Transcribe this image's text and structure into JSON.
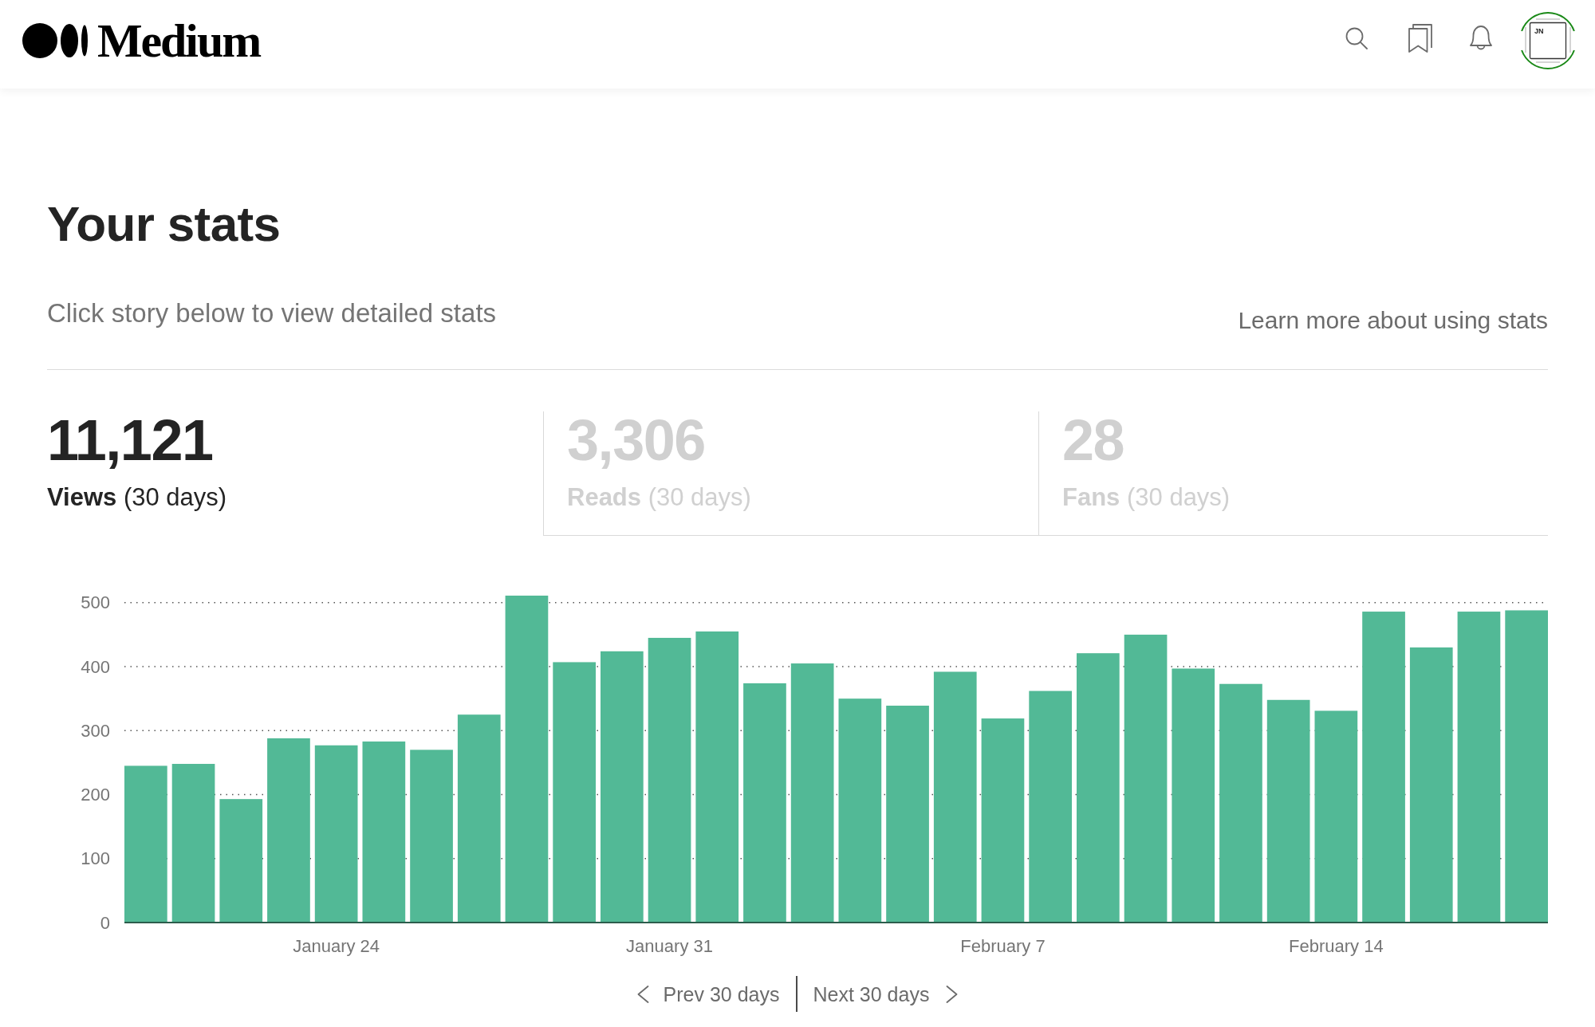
{
  "header": {
    "logo": "Medium",
    "avatar": {
      "initials": "JN"
    }
  },
  "page": {
    "title": "Your stats",
    "subtitle": "Click story below to view detailed stats",
    "help_link": "Learn more about using stats"
  },
  "stats": [
    {
      "value": "11,121",
      "label": "**Views** (30 days)",
      "selected": true
    },
    {
      "value": "3,306",
      "label": "**Reads** (30 days)",
      "selected": false
    },
    {
      "value": "28",
      "label": "**Fans** (30 days)",
      "selected": false
    }
  ],
  "views_chart": {
    "chart_data": {
      "type": "bar",
      "categories": [
        null,
        null,
        null,
        null,
        "January 24",
        null,
        null,
        null,
        null,
        null,
        null,
        "January 31",
        null,
        null,
        null,
        null,
        null,
        null,
        "February 7",
        null,
        null,
        null,
        null,
        null,
        null,
        "February 14",
        null,
        null,
        null,
        null
      ],
      "values": [
        245,
        248,
        193,
        288,
        277,
        283,
        270,
        325,
        511,
        407,
        424,
        445,
        455,
        374,
        405,
        350,
        339,
        392,
        319,
        362,
        421,
        450,
        397,
        373,
        348,
        331,
        486,
        430,
        486,
        488
      ],
      "color": "#52b996",
      "ylim": [
        0,
        511
      ],
      "yticks": [
        0,
        100,
        200,
        300,
        400,
        500
      ],
      "grid": true
    }
  },
  "pagination": {
    "prev": "Prev 30 days",
    "next": "Next 30 days"
  }
}
